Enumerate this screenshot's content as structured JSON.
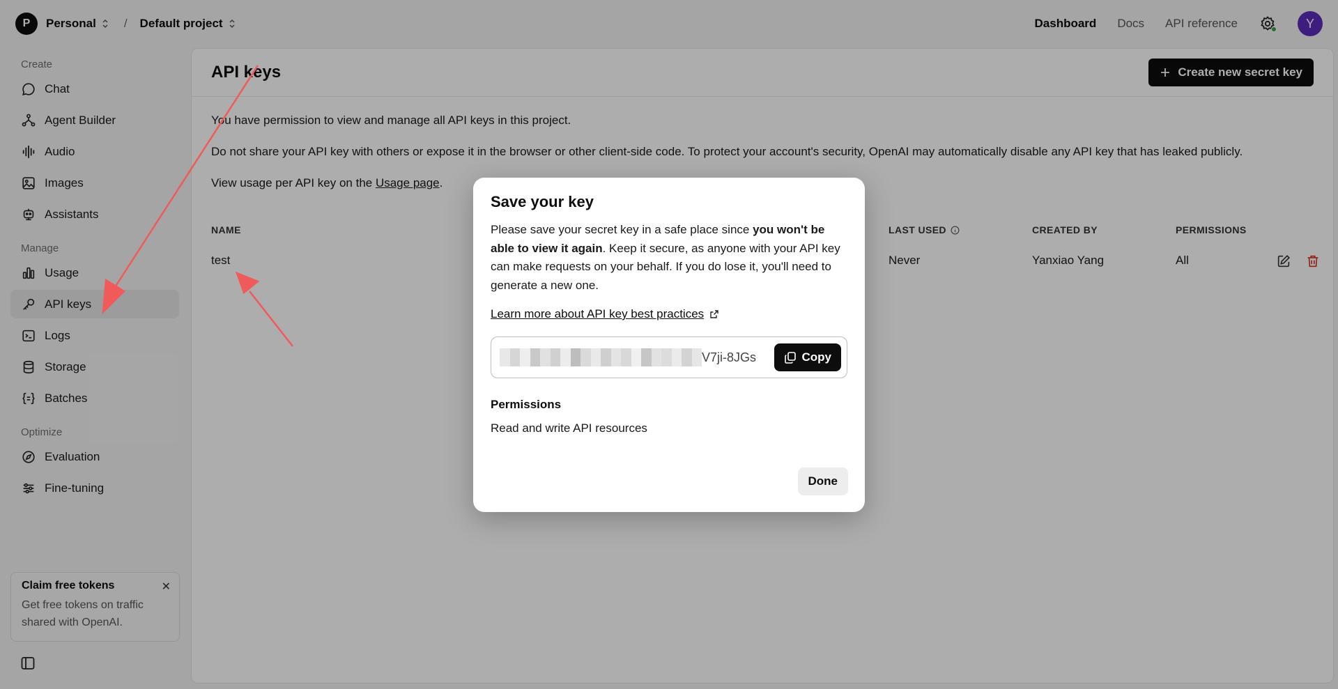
{
  "topbar": {
    "org_initial": "P",
    "org_name": "Personal",
    "separator": "/",
    "project_name": "Default project",
    "nav": [
      "Dashboard",
      "Docs",
      "API reference"
    ],
    "user_initial": "Y"
  },
  "sidebar": {
    "sections": {
      "create": "Create",
      "manage": "Manage",
      "optimize": "Optimize"
    },
    "create_items": [
      {
        "label": "Chat",
        "icon": "chat-bubble-icon"
      },
      {
        "label": "Agent Builder",
        "icon": "agent-builder-icon"
      },
      {
        "label": "Audio",
        "icon": "audio-waveform-icon"
      },
      {
        "label": "Images",
        "icon": "image-icon"
      },
      {
        "label": "Assistants",
        "icon": "robot-icon"
      }
    ],
    "manage_items": [
      {
        "label": "Usage",
        "icon": "bar-chart-icon"
      },
      {
        "label": "API keys",
        "icon": "key-icon",
        "active": true
      },
      {
        "label": "Logs",
        "icon": "terminal-icon"
      },
      {
        "label": "Storage",
        "icon": "database-icon"
      },
      {
        "label": "Batches",
        "icon": "braces-icon"
      }
    ],
    "optimize_items": [
      {
        "label": "Evaluation",
        "icon": "compass-icon"
      },
      {
        "label": "Fine-tuning",
        "icon": "sliders-icon"
      }
    ],
    "promo": {
      "title": "Claim free tokens",
      "text": "Get free tokens on traffic shared with OpenAI.",
      "close": "✕"
    }
  },
  "main": {
    "title": "API keys",
    "create_button": "Create new secret key",
    "para1": "You have permission to view and manage all API keys in this project.",
    "para2": "Do not share your API key with others or expose it in the browser or other client-side code. To protect your account's security, OpenAI may automatically disable any API key that has leaked publicly.",
    "para3_prefix": "View usage per API key on the ",
    "para3_link": "Usage page",
    "para3_suffix": ".",
    "table": {
      "headers": {
        "name": "NAME",
        "last_used": "LAST USED",
        "created_by": "CREATED BY",
        "permissions": "PERMISSIONS"
      },
      "rows": [
        {
          "name": "test",
          "last_used": "Never",
          "created_by": "Yanxiao Yang",
          "permissions": "All"
        }
      ]
    }
  },
  "modal": {
    "title": "Save your key",
    "text_start": "Please save your secret key in a safe place since ",
    "text_bold": "you won't be able to view it again",
    "text_end": ". Keep it secure, as anyone with your API key can make requests on your behalf. If you do lose it, you'll need to generate a new one.",
    "learn_link": "Learn more about API key best practices",
    "key_tail": "V7ji-8JGs",
    "copy_label": "Copy",
    "permissions_label": "Permissions",
    "permissions_value": "Read and write API resources",
    "done_label": "Done"
  },
  "colors": {
    "accent_dark": "#0d0d0d",
    "avatar_purple": "#5b2bb8",
    "delete_red": "#d93025",
    "annotation_red": "#f05a5a"
  }
}
